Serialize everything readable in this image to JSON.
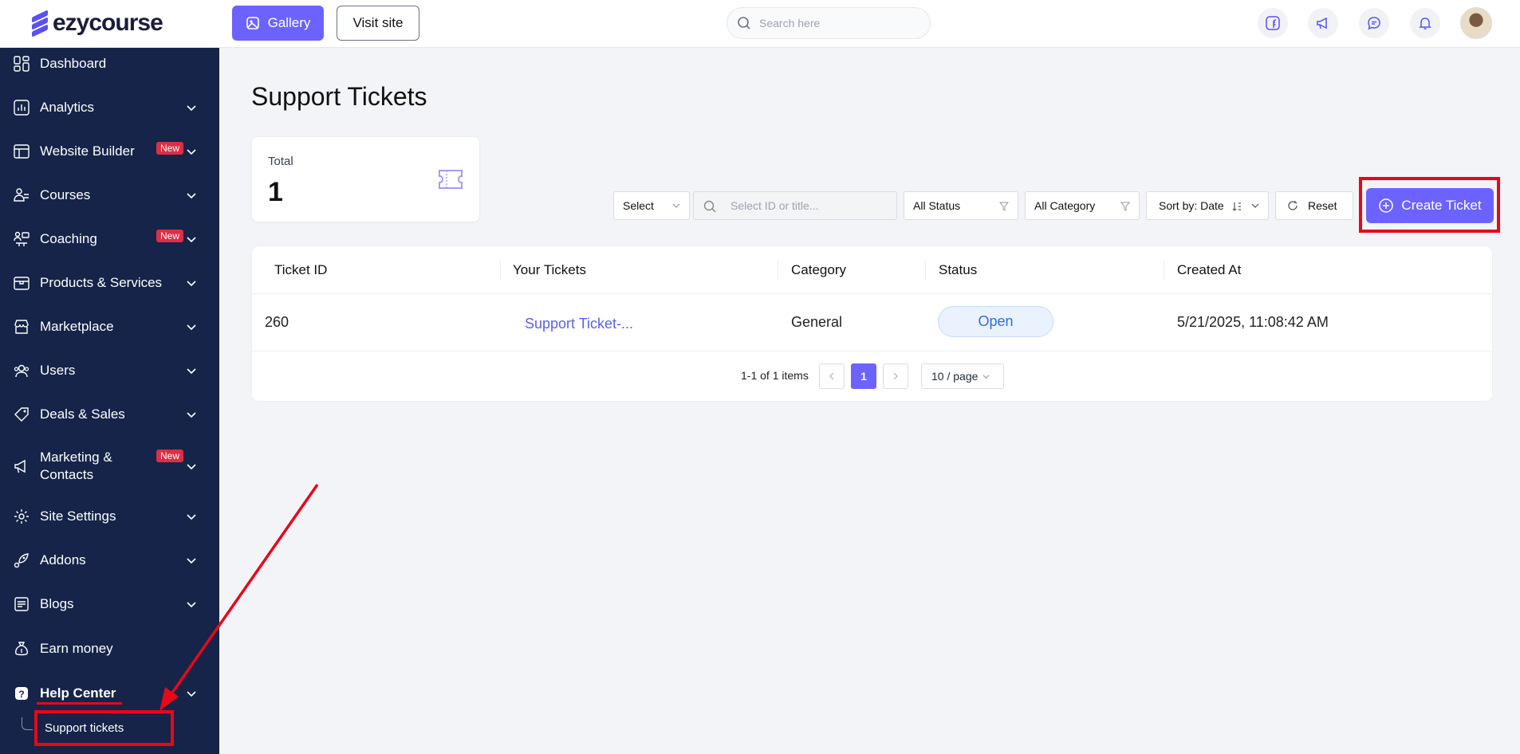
{
  "brand": {
    "name": "ezycourse"
  },
  "header": {
    "gallery_label": "Gallery",
    "visit_site_label": "Visit site",
    "search_placeholder": "Search here",
    "icons": [
      "facebook-icon",
      "megaphone-icon",
      "chat-icon",
      "bell-icon"
    ]
  },
  "sidebar": {
    "items": [
      {
        "label": "Dashboard",
        "icon": "dashboard-icon",
        "new": false,
        "chevron": false
      },
      {
        "label": "Analytics",
        "icon": "analytics-icon",
        "new": false,
        "chevron": true
      },
      {
        "label": "Website Builder",
        "icon": "website-builder-icon",
        "new": true,
        "chevron": true
      },
      {
        "label": "Courses",
        "icon": "courses-icon",
        "new": false,
        "chevron": true
      },
      {
        "label": "Coaching",
        "icon": "coaching-icon",
        "new": true,
        "chevron": true
      },
      {
        "label": "Products & Services",
        "icon": "products-icon",
        "new": false,
        "chevron": true
      },
      {
        "label": "Marketplace",
        "icon": "marketplace-icon",
        "new": false,
        "chevron": true
      },
      {
        "label": "Users",
        "icon": "users-icon",
        "new": false,
        "chevron": true
      },
      {
        "label": "Deals & Sales",
        "icon": "tag-icon",
        "new": false,
        "chevron": true
      },
      {
        "label": "Marketing & Contacts",
        "icon": "megaphone-icon",
        "new": true,
        "chevron": true
      },
      {
        "label": "Site Settings",
        "icon": "gear-icon",
        "new": false,
        "chevron": true
      },
      {
        "label": "Addons",
        "icon": "rocket-icon",
        "new": false,
        "chevron": true
      },
      {
        "label": "Blogs",
        "icon": "blog-icon",
        "new": false,
        "chevron": true
      },
      {
        "label": "Earn money",
        "icon": "money-bag-icon",
        "new": false,
        "chevron": false
      },
      {
        "label": "Help Center",
        "icon": "help-icon",
        "new": false,
        "chevron": true
      }
    ],
    "new_badge": "New",
    "sub_item": "Support tickets"
  },
  "main": {
    "title": "Support Tickets",
    "total_card": {
      "label": "Total",
      "value": "1"
    },
    "filters": {
      "select": "Select",
      "search_placeholder": "Select ID or title...",
      "status": "All Status",
      "category": "All Category",
      "sort": "Sort by: Date",
      "reset": "Reset"
    },
    "create_ticket_label": "Create Ticket",
    "table": {
      "columns": [
        "Ticket ID",
        "Your Tickets",
        "Category",
        "Status",
        "Created At"
      ],
      "rows": [
        {
          "id": "260",
          "title": "Support Ticket-...",
          "category": "General",
          "status": "Open",
          "created_at": "5/21/2025, 11:08:42 AM"
        }
      ]
    },
    "pagination": {
      "summary": "1-1 of 1 items",
      "current_page": "1",
      "per_page": "10 / page"
    }
  },
  "colors": {
    "accent": "#6c63ff",
    "sidebar": "#152448",
    "annotation": "#e8071a",
    "badge": "#dc2f45"
  }
}
